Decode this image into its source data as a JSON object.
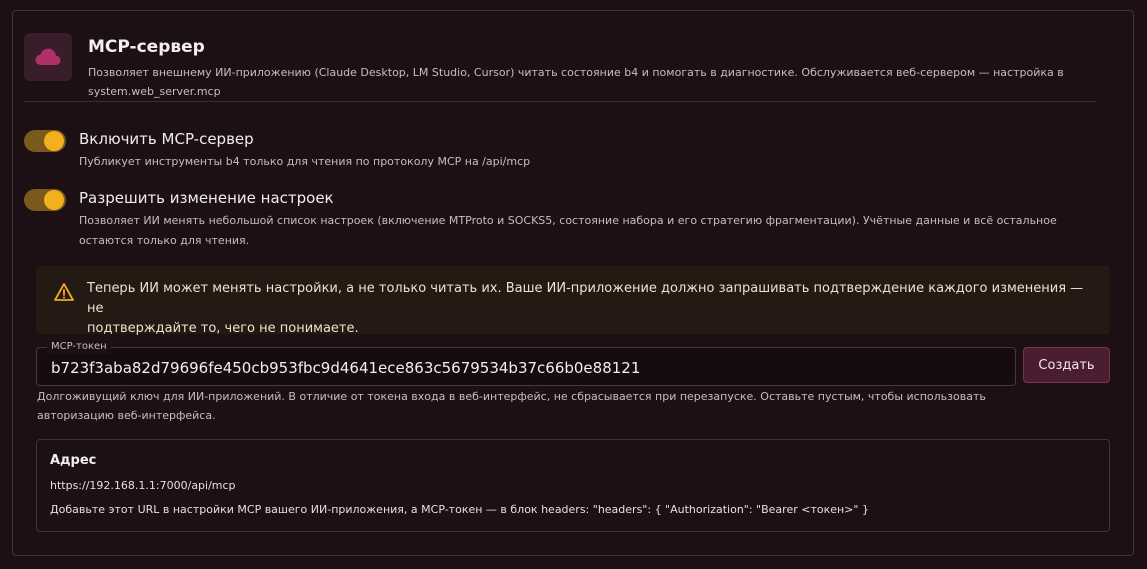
{
  "header": {
    "icon": "cloud-icon",
    "title": "MCP-сервер",
    "description_line1": "Позволяет внешнему ИИ-приложению (Claude Desktop, LM Studio, Cursor) читать состояние b4 и помогать в диагностике. Обслуживается веб-сервером — настройка в",
    "description_line2": "system.web_server.mcp"
  },
  "toggles": [
    {
      "label": "Включить MCP-сервер",
      "description_line1": "Публикует инструменты b4 только для чтения по протоколу MCP на /api/mcp",
      "checked": true
    },
    {
      "label": "Разрешить изменение настроек",
      "description_line1": "Позволяет ИИ менять небольшой список настроек (включение MTProto и SOCKS5, состояние набора и его стратегию фрагментации). Учётные данные и всё остальное",
      "description_line2": "остаются только для чтения.",
      "checked": true
    }
  ],
  "alert": {
    "icon": "warning-triangle-icon",
    "line1": "Теперь ИИ может менять настройки, а не только читать их. Ваше ИИ-приложение должно запрашивать подтверждение каждого изменения — не",
    "line2": "подтверждайте то, чего не понимаете."
  },
  "token": {
    "label": "MCP-токен",
    "value": "b723f3aba82d79696fe450cb953fbc9d4641ece863c5679534b37c66b0e88121",
    "create_button": "Создать",
    "help_line1": "Долгоживущий ключ для ИИ-приложений. В отличие от токена входа в веб-интерфейс, не сбрасывается при перезапуске. Оставьте пустым, чтобы использовать",
    "help_line2": "авторизацию веб-интерфейса."
  },
  "address": {
    "title": "Адрес",
    "url": "https://192.168.1.1:7000/api/mcp",
    "help": "Добавьте этот URL в настройки MCP вашего ИИ-приложения, а MCP-токен — в блок headers: \"headers\": { \"Authorization\": \"Bearer <токен>\" }"
  },
  "colors": {
    "accent": "#f2b01e",
    "brand": "#b0306a",
    "background": "#1c1014"
  }
}
